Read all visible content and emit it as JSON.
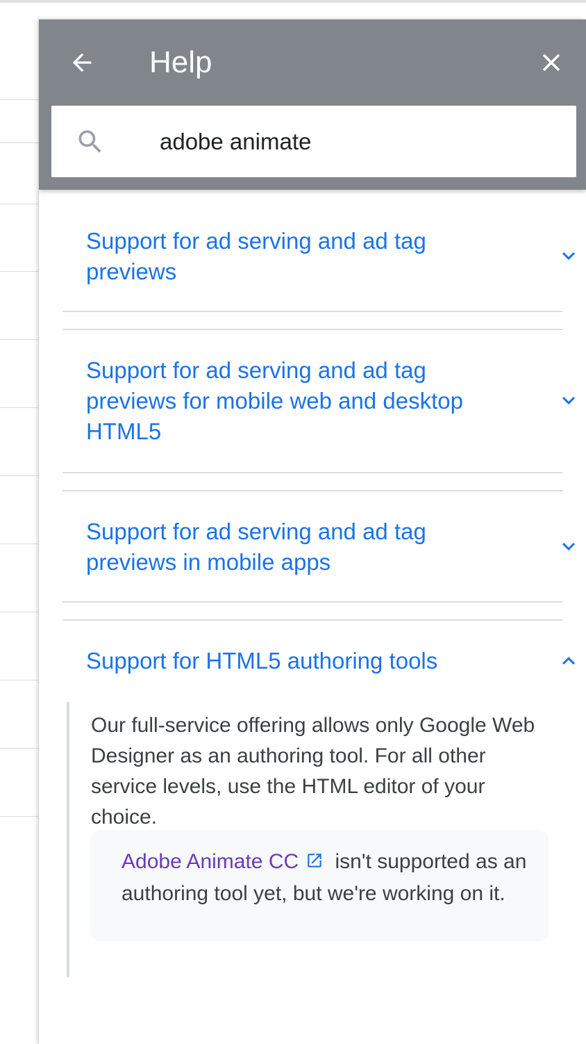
{
  "header": {
    "title": "Help",
    "back_icon": "arrow-back-icon",
    "close_icon": "close-icon",
    "background_color": "#80868b"
  },
  "search": {
    "value": "adobe animate",
    "icon": "search-icon"
  },
  "articles": [
    {
      "label": "Support for ad serving and ad tag previews",
      "expanded": false
    },
    {
      "label": "Support for ad serving and ad tag previews for mobile web and desktop HTML5",
      "expanded": false
    },
    {
      "label": "Support for ad serving and ad tag previews in mobile apps",
      "expanded": false
    },
    {
      "label": "Support for HTML5 authoring tools",
      "expanded": true,
      "body": "Our full-service offering allows only Google Web Designer as an authoring tool. For all other service levels, use the HTML editor of your choice.",
      "note": {
        "link_text": "Adobe Animate CC",
        "link_icon": "external-link-icon",
        "text": " isn't supported as an authoring tool yet, but we're working on it."
      }
    }
  ],
  "colors": {
    "link_blue": "#1a73e8",
    "visited_link_purple": "#6a3ab8",
    "body_text": "#3c4043",
    "divider": "#dadce0"
  }
}
